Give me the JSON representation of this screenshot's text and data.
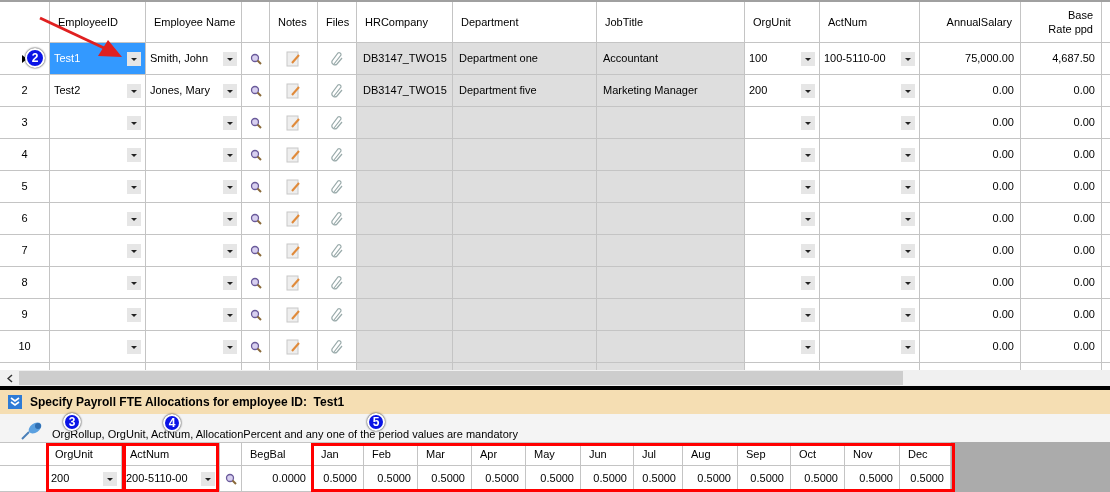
{
  "grid": {
    "columns": [
      {
        "kind": "rownum"
      },
      {
        "label": "EmployeeID",
        "kind": "combo"
      },
      {
        "label": "Employee Name",
        "kind": "combo"
      },
      {
        "kind": "search"
      },
      {
        "label": "Notes",
        "kind": "notes"
      },
      {
        "label": "Files",
        "kind": "files"
      },
      {
        "label": "HRCompany",
        "kind": "readonly"
      },
      {
        "label": "Department",
        "kind": "readonly"
      },
      {
        "label": "JobTitle",
        "kind": "readonly"
      },
      {
        "label": "OrgUnit",
        "kind": "combo"
      },
      {
        "label": "ActNum",
        "kind": "combo"
      },
      {
        "label": "AnnualSalary",
        "kind": "number"
      },
      {
        "label": "Base\nRate ppd",
        "kind": "number"
      }
    ],
    "rows": [
      {
        "selected": true,
        "employee_id": "Test1",
        "employee_name": "Smith, John",
        "hr_company": "DB3147_TWO15",
        "department": "Department one",
        "job_title": "Accountant",
        "org_unit": "100",
        "act_num": "100-5110-00",
        "annual_salary": "75,000.00",
        "base_rate": "4,687.50"
      },
      {
        "number": "2",
        "selected": false,
        "employee_id": "Test2",
        "employee_name": "Jones, Mary",
        "hr_company": "DB3147_TWO15",
        "department": "Department five",
        "job_title": "Marketing Manager",
        "org_unit": "200",
        "annual_salary": "0.00",
        "base_rate": "0.00"
      },
      {
        "number": "3",
        "selected": false,
        "annual_salary": "0.00",
        "base_rate": "0.00"
      },
      {
        "number": "4",
        "selected": false,
        "annual_salary": "0.00",
        "base_rate": "0.00"
      },
      {
        "number": "5",
        "selected": false,
        "annual_salary": "0.00",
        "base_rate": "0.00"
      },
      {
        "number": "6",
        "selected": false,
        "annual_salary": "0.00",
        "base_rate": "0.00"
      },
      {
        "number": "7",
        "selected": false,
        "annual_salary": "0.00",
        "base_rate": "0.00"
      },
      {
        "number": "8",
        "selected": false,
        "annual_salary": "0.00",
        "base_rate": "0.00"
      },
      {
        "number": "9",
        "selected": false,
        "annual_salary": "0.00",
        "base_rate": "0.00"
      },
      {
        "number": "10",
        "selected": false,
        "annual_salary": "0.00",
        "base_rate": "0.00"
      }
    ]
  },
  "allocation": {
    "title": "Specify Payroll FTE Allocations for employee ID:  Test1",
    "note": "OrgRollup, OrgUnit, ActNum, AllocationPercent and any one of the period values are mandatory",
    "columns": [
      {
        "kind": "rownum"
      },
      {
        "label": "OrgUnit",
        "kind": "combo"
      },
      {
        "label": "ActNum",
        "kind": "combo"
      },
      {
        "kind": "search"
      },
      {
        "label": "BegBal",
        "kind": "number"
      },
      {
        "label": "Jan",
        "kind": "number"
      },
      {
        "label": "Feb",
        "kind": "number"
      },
      {
        "label": "Mar",
        "kind": "number"
      },
      {
        "label": "Apr",
        "kind": "number"
      },
      {
        "label": "May",
        "kind": "number"
      },
      {
        "label": "Jun",
        "kind": "number"
      },
      {
        "label": "Jul",
        "kind": "number"
      },
      {
        "label": "Aug",
        "kind": "number"
      },
      {
        "label": "Sep",
        "kind": "number"
      },
      {
        "label": "Oct",
        "kind": "number"
      },
      {
        "label": "Nov",
        "kind": "number"
      },
      {
        "label": "Dec",
        "kind": "number"
      }
    ],
    "row": {
      "org_unit": "200",
      "act_num": "200-5110-00",
      "beg_bal": "0.0000",
      "periods": [
        "0.5000",
        "0.5000",
        "0.5000",
        "0.5000",
        "0.5000",
        "0.5000",
        "0.5000",
        "0.5000",
        "0.5000",
        "0.5000",
        "0.5000",
        "0.5000"
      ]
    }
  },
  "callouts": [
    {
      "label": "2"
    },
    {
      "label": "3"
    },
    {
      "label": "4"
    },
    {
      "label": "5"
    }
  ]
}
